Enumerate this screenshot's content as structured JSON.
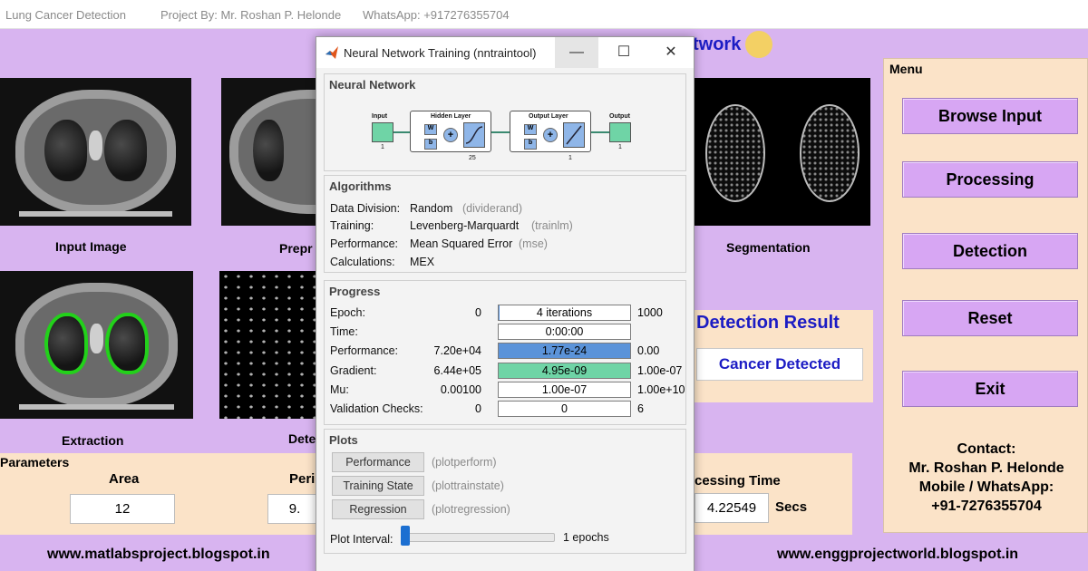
{
  "titlebar": {
    "app": "Lung Cancer Detection",
    "project": "Project By: Mr. Roshan P. Helonde",
    "whatsapp": "WhatsApp: +917276355704"
  },
  "background_title_fragment": "twork",
  "panels": {
    "input_label": "Input Image",
    "preprocess_label": "Prepr",
    "segmentation_label": "Segmentation",
    "extraction_label": "Extraction",
    "detection_label": "Dete"
  },
  "menu": {
    "title": "Menu",
    "buttons": [
      "Browse Input",
      "Processing",
      "Detection",
      "Reset",
      "Exit"
    ],
    "contact": [
      "Contact:",
      "Mr. Roshan P. Helonde",
      "Mobile / WhatsApp:",
      "+91-7276355704"
    ]
  },
  "result": {
    "title": "Detection Result",
    "value": "Cancer Detected"
  },
  "parameters": {
    "title": "Parameters",
    "area_label": "Area",
    "area_value": "12",
    "perimeter_label": "Peri",
    "perimeter_value": "9.",
    "time_label": "cessing Time",
    "time_value": "4.22549",
    "time_unit": "Secs"
  },
  "footer": {
    "left_url": "www.matlabsproject.blogspot.in",
    "right_url": "www.enggprojectworld.blogspot.in"
  },
  "nntraintool": {
    "title": "Neural Network Training (nntraintool)",
    "window_controls": [
      "—",
      "☐",
      "✕"
    ],
    "network": {
      "title": "Neural Network",
      "input": "Input",
      "input_size": "1",
      "hidden": "Hidden Layer",
      "hidden_size": "25",
      "output_layer": "Output Layer",
      "output_layer_size": "1",
      "output": "Output",
      "output_size": "1",
      "w": "W",
      "b": "b",
      "plus": "+"
    },
    "algorithms": {
      "title": "Algorithms",
      "rows": [
        {
          "label": "Data Division:",
          "value": "Random",
          "fn": "(dividerand)"
        },
        {
          "label": "Training:",
          "value": "Levenberg-Marquardt",
          "fn": "(trainlm)"
        },
        {
          "label": "Performance:",
          "value": "Mean Squared Error",
          "fn": "(mse)"
        },
        {
          "label": "Calculations:",
          "value": "MEX",
          "fn": ""
        }
      ]
    },
    "progress": {
      "title": "Progress",
      "rows": [
        {
          "label": "Epoch:",
          "start": "0",
          "current": "4 iterations",
          "end": "1000",
          "fill": 0.004,
          "color": "#5b93d9"
        },
        {
          "label": "Time:",
          "start": "",
          "current": "0:00:00",
          "end": "",
          "fill": 0,
          "color": "#5b93d9"
        },
        {
          "label": "Performance:",
          "start": "7.20e+04",
          "current": "1.77e-24",
          "end": "0.00",
          "fill": 1,
          "color": "#5b93d9"
        },
        {
          "label": "Gradient:",
          "start": "6.44e+05",
          "current": "4.95e-09",
          "end": "1.00e-07",
          "fill": 1,
          "color": "#6fd4a6"
        },
        {
          "label": "Mu:",
          "start": "0.00100",
          "current": "1.00e-07",
          "end": "1.00e+10",
          "fill": 0,
          "color": "#5b93d9"
        },
        {
          "label": "Validation Checks:",
          "start": "0",
          "current": "0",
          "end": "6",
          "fill": 0,
          "color": "#5b93d9"
        }
      ]
    },
    "plots": {
      "title": "Plots",
      "buttons": [
        {
          "label": "Performance",
          "fn": "(plotperform)"
        },
        {
          "label": "Training State",
          "fn": "(plottrainstate)"
        },
        {
          "label": "Regression",
          "fn": "(plotregression)"
        }
      ],
      "interval_label": "Plot Interval:",
      "interval_value": "1 epochs"
    }
  }
}
